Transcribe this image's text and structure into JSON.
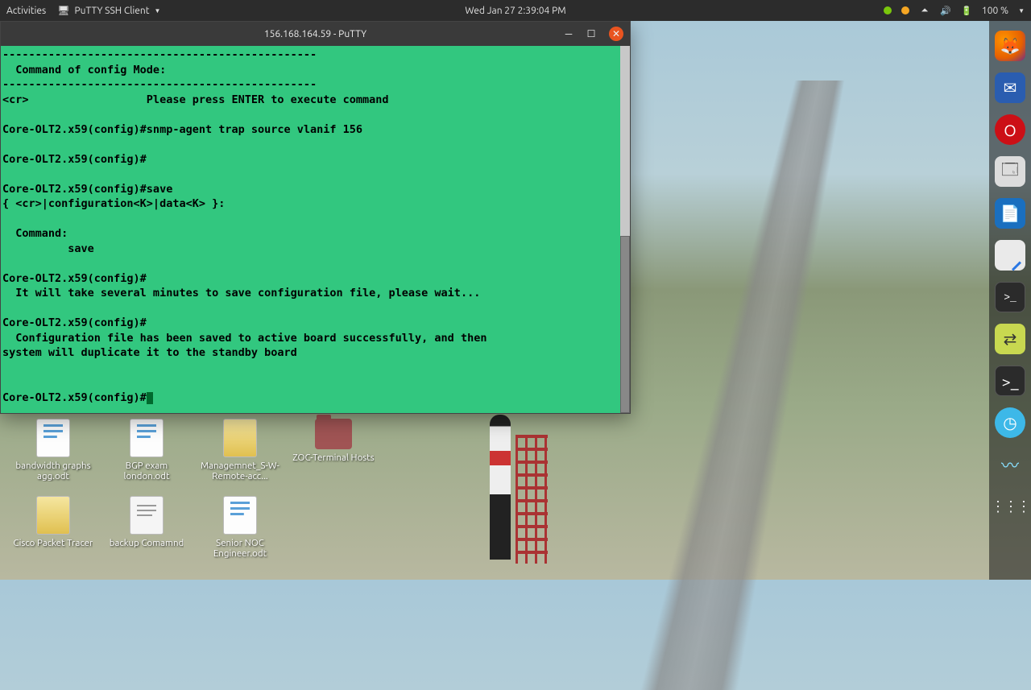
{
  "topbar": {
    "activities": "Activities",
    "app_icon": "putty-icon",
    "app_name": "PuTTY SSH Client",
    "datetime": "Wed Jan 27  2:39:04 PM",
    "battery": "100 %"
  },
  "putty": {
    "title": "156.168.164.59 - PuTTY",
    "lines": [
      "------------------------------------------------",
      "  Command of config Mode:",
      "------------------------------------------------",
      "<cr>                  Please press ENTER to execute command",
      "",
      "Core-OLT2.x59(config)#snmp-agent trap source vlanif 156",
      "",
      "Core-OLT2.x59(config)#",
      "",
      "Core-OLT2.x59(config)#save",
      "{ <cr>|configuration<K>|data<K> }:",
      "",
      "  Command:",
      "          save",
      "",
      "Core-OLT2.x59(config)#",
      "  It will take several minutes to save configuration file, please wait...",
      "",
      "Core-OLT2.x59(config)#",
      "  Configuration file has been saved to active board successfully, and then",
      "system will duplicate it to the standby board",
      "",
      "",
      "Core-OLT2.x59(config)#"
    ]
  },
  "desktop": {
    "icons": [
      {
        "label": "bandwidth graphs agg.odt",
        "kind": "doc"
      },
      {
        "label": "BGP exam london.odt",
        "kind": "doc"
      },
      {
        "label": "Managemnet_S-W-Remote-acc...",
        "kind": "app"
      },
      {
        "label": "ZOC-Terminal Hosts",
        "kind": "folder"
      },
      {
        "label": "Cisco Packet Tracer",
        "kind": "app"
      },
      {
        "label": "backup Comamnd",
        "kind": "txt"
      },
      {
        "label": "Senior NOC Engineer.odt",
        "kind": "doc"
      }
    ]
  },
  "dock": {
    "items": [
      "firefox",
      "thunderbird",
      "opera",
      "files",
      "writer",
      "gedit",
      "terminal",
      "putty",
      "terminal2",
      "winbox",
      "edge",
      "apps"
    ]
  }
}
